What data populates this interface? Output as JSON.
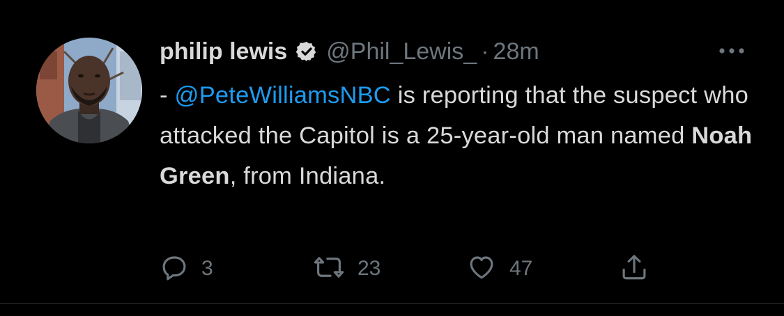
{
  "tweet": {
    "display_name": "philip lewis",
    "handle": "@Phil_Lewis_",
    "separator": "·",
    "time": "28m",
    "text": {
      "prefix": "- ",
      "mention": "@PeteWilliamsNBC",
      "part1": " is reporting that the suspect who attacked the Capitol is a 25-year-old man named ",
      "bold_name": "Noah Green",
      "part2": ", from Indiana."
    },
    "actions": {
      "reply_count": "3",
      "retweet_count": "23",
      "like_count": "47"
    }
  },
  "icons": {
    "verified": "verified-badge-icon",
    "more": "more-options-icon",
    "reply": "reply-icon",
    "retweet": "retweet-icon",
    "like": "heart-icon",
    "share": "share-icon"
  },
  "colors": {
    "background": "#000000",
    "text": "#d9d9d9",
    "secondary": "#6e767d",
    "link": "#1d9bf0"
  }
}
